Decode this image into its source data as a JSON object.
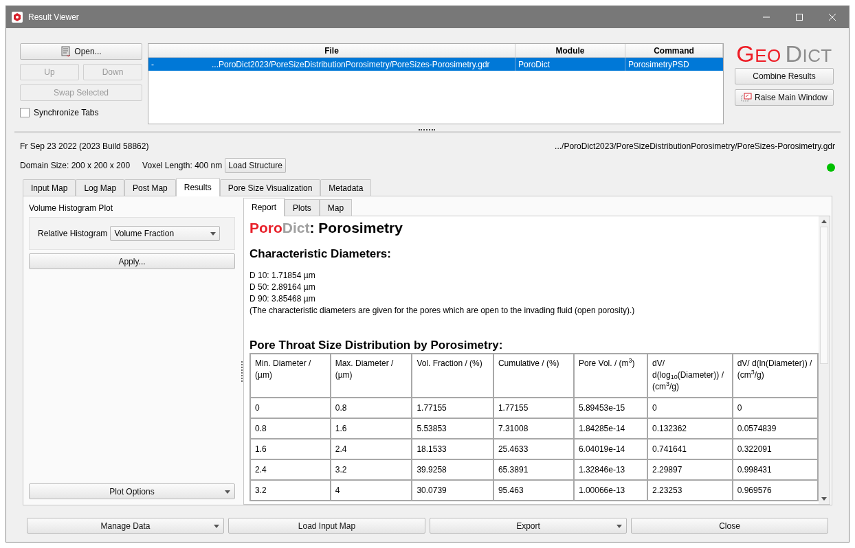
{
  "window": {
    "title": "Result Viewer"
  },
  "left_buttons": {
    "open": "Open...",
    "up": "Up",
    "down": "Down",
    "swap": "Swap Selected",
    "sync": {
      "label": "Synchronize Tabs",
      "checked": false
    }
  },
  "file_table": {
    "columns": [
      "File",
      "Module",
      "Command"
    ],
    "rows": [
      {
        "marker": "-",
        "cells": [
          "...PoroDict2023/PoreSizeDistributionPorosimetry/PoreSizes-Porosimetry.gdr",
          "PoroDict",
          "PorosimetryPSD"
        ],
        "selected": true
      }
    ]
  },
  "logo": [
    {
      "text": "GEO",
      "color": "#ee1c25"
    },
    {
      "text": "DICT",
      "color": "#8c8c8c"
    }
  ],
  "right_buttons": [
    "Combine Results",
    "Raise Main Window"
  ],
  "info": {
    "date": "Fr Sep 23 2022 (2023 Build 58862)",
    "path": ".../PoroDict2023/PoreSizeDistributionPorosimetry/PoreSizes-Porosimetry.gdr",
    "domain": "Domain Size: 200 x 200 x 200",
    "voxel": "Voxel Length: 400 nm",
    "load_button": "Load Structure",
    "status": {
      "color": "#00c000"
    }
  },
  "tabs": [
    {
      "label": "Input Map",
      "selected": false
    },
    {
      "label": "Log Map",
      "selected": false
    },
    {
      "label": "Post Map",
      "selected": false
    },
    {
      "label": "Results",
      "selected": true
    },
    {
      "label": "Pore Size Visualization",
      "selected": false
    },
    {
      "label": "Metadata",
      "selected": false
    }
  ],
  "left_panel": {
    "title": "Volume Histogram Plot",
    "field_label": "Relative Histogram",
    "field_value": "Volume Fraction",
    "apply": "Apply...",
    "plot_options": "Plot Options"
  },
  "sub_tabs": [
    {
      "label": "Report",
      "selected": true
    },
    {
      "label": "Plots",
      "selected": false
    },
    {
      "label": "Map",
      "selected": false
    }
  ],
  "report": {
    "title_parts": [
      {
        "text": "Poro",
        "color": "#e8202a"
      },
      {
        "text": "Dict",
        "color": "#a0a0a0"
      },
      {
        "text": ": Porosimetry",
        "color": "#000000"
      }
    ],
    "heading": "Characteristic Diameters:",
    "lines": [
      "D 10: 1.71854 µm",
      "D 50: 2.89164 µm",
      "D 90: 3.85468 µm",
      "(The characteristic diameters are given for the pores which are open to the invading fluid (open porosity).)"
    ],
    "table_title": "Pore Throat Size Distribution by Porosimetry:",
    "table": {
      "columns": [
        "Min. Diameter / (µm)",
        "Max. Diameter / (µm)",
        "Vol. Fraction / (%)",
        "Cumulative / (%)",
        "Pore Vol. / (m$^{3}$)",
        "dV/ d(log$_{10}$(Diameter)) / (cm$^{3}$/g)",
        "dV/ d(ln(Diameter)) / (cm$^{3}$/g)"
      ],
      "rows": [
        [
          "0",
          "0.8",
          "1.77155",
          "1.77155",
          "5.89453e-15",
          "0",
          "0"
        ],
        [
          "0.8",
          "1.6",
          "5.53853",
          "7.31008",
          "1.84285e-14",
          "0.132362",
          "0.0574839"
        ],
        [
          "1.6",
          "2.4",
          "18.1533",
          "25.4633",
          "6.04019e-14",
          "0.741641",
          "0.322091"
        ],
        [
          "2.4",
          "3.2",
          "39.9258",
          "65.3891",
          "1.32846e-13",
          "2.29897",
          "0.998431"
        ],
        [
          "3.2",
          "4",
          "30.0739",
          "95.463",
          "1.00066e-13",
          "2.23253",
          "0.969576"
        ]
      ]
    }
  },
  "bottom_buttons": [
    {
      "label": "Manage Data",
      "dropdown": true
    },
    {
      "label": "Load Input Map",
      "dropdown": false
    },
    {
      "label": "Export",
      "dropdown": true
    },
    {
      "label": "Close",
      "dropdown": false
    }
  ]
}
